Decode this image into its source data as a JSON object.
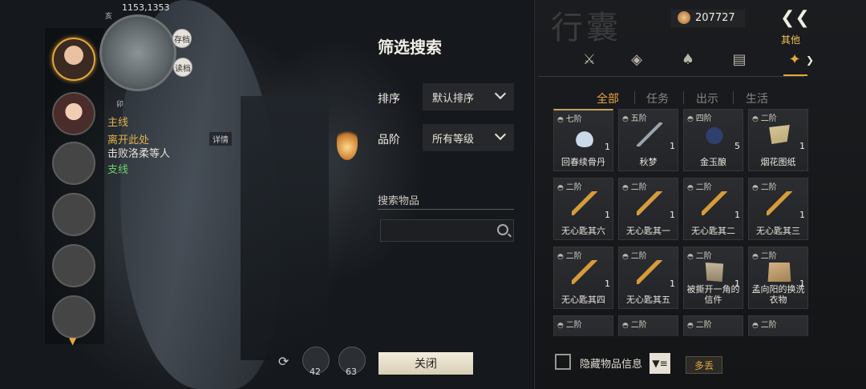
{
  "hud": {
    "coords": "1153,1353",
    "minimap_labels": [
      "亥",
      "卯"
    ],
    "save_label": "存档",
    "load_label": "读档",
    "quest": {
      "main_label": "主线",
      "main_title": "离开此处",
      "main_desc": "击败洛柔等人",
      "detail_label": "详情",
      "side_label": "支线"
    },
    "skills": [
      {
        "count": "42"
      },
      {
        "count": "63"
      }
    ]
  },
  "filter": {
    "title": "筛选搜索",
    "sort_label": "排序",
    "sort_value": "默认排序",
    "grade_label": "品阶",
    "grade_value": "所有等级",
    "search_label": "搜索物品",
    "search_placeholder": "",
    "close_label": "关闭"
  },
  "inventory": {
    "title": "行囊",
    "currency": "207727",
    "category_label": "其他",
    "subtabs": [
      "全部",
      "任务",
      "出示",
      "生活"
    ],
    "items": [
      {
        "tier": "七阶",
        "qty": "1",
        "name": "回春续骨丹",
        "art": "vial"
      },
      {
        "tier": "五阶",
        "qty": "1",
        "name": "秋梦",
        "art": "sword"
      },
      {
        "tier": "四阶",
        "qty": "5",
        "name": "金玉酿",
        "art": "jar"
      },
      {
        "tier": "二阶",
        "qty": "1",
        "name": "烟花图纸",
        "art": "paper"
      },
      {
        "tier": "二阶",
        "qty": "1",
        "name": "无心匙其六",
        "art": "key"
      },
      {
        "tier": "二阶",
        "qty": "1",
        "name": "无心匙其一",
        "art": "key"
      },
      {
        "tier": "二阶",
        "qty": "1",
        "name": "无心匙其二",
        "art": "key"
      },
      {
        "tier": "二阶",
        "qty": "1",
        "name": "无心匙其三",
        "art": "key"
      },
      {
        "tier": "二阶",
        "qty": "1",
        "name": "无心匙其四",
        "art": "key"
      },
      {
        "tier": "二阶",
        "qty": "1",
        "name": "无心匙其五",
        "art": "key"
      },
      {
        "tier": "二阶",
        "qty": "1",
        "name": "被撕开一角的信件",
        "art": "scroll"
      },
      {
        "tier": "二阶",
        "qty": "1",
        "name": "孟向阳的换洗衣物",
        "art": "robe"
      },
      {
        "tier": "二阶",
        "qty": "",
        "name": "",
        "art": ""
      },
      {
        "tier": "二阶",
        "qty": "",
        "name": "",
        "art": ""
      },
      {
        "tier": "二阶",
        "qty": "",
        "name": "",
        "art": ""
      },
      {
        "tier": "二阶",
        "qty": "",
        "name": "",
        "art": ""
      }
    ],
    "hide_info_label": "隐藏物品信息",
    "multi_drop_label": "多丢"
  }
}
